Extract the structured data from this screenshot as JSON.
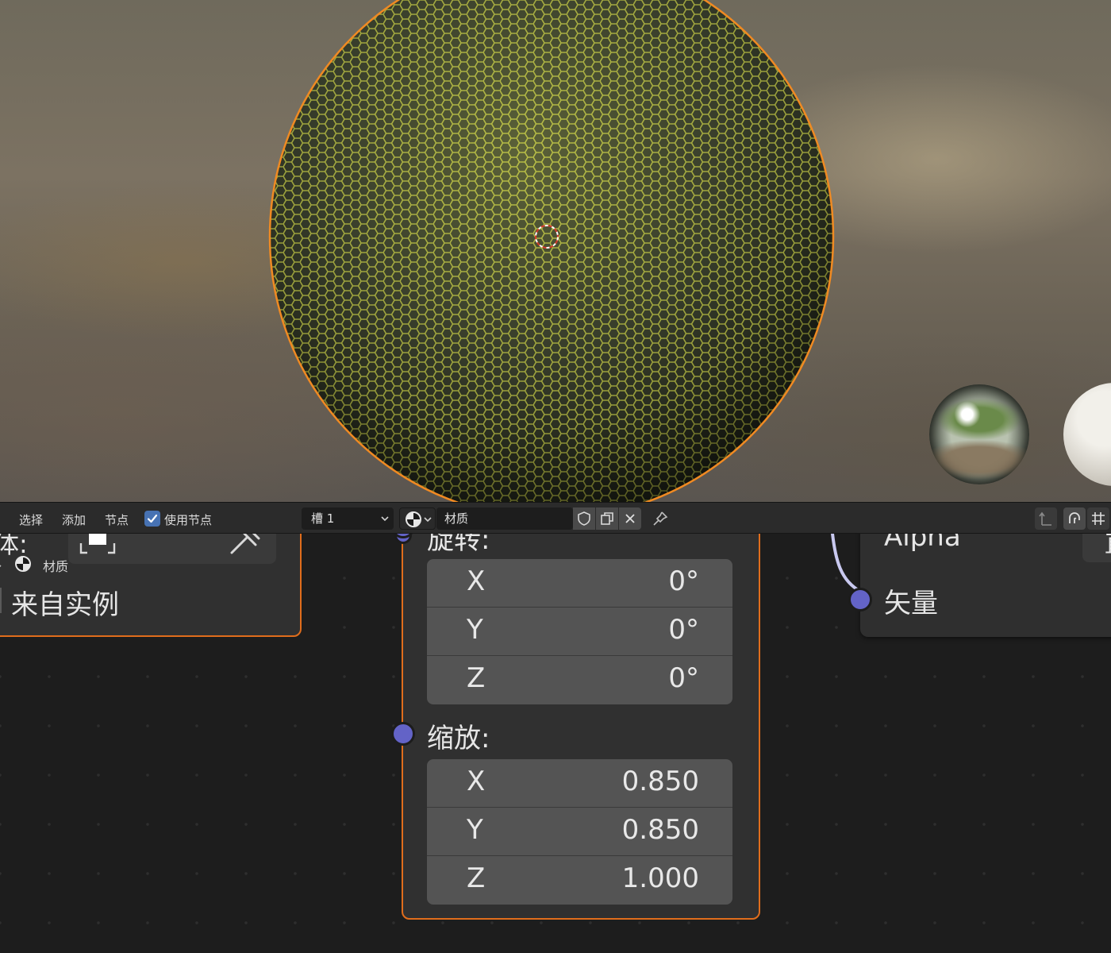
{
  "header": {
    "menu": [
      "选择",
      "添加",
      "节点"
    ],
    "use_nodes_label": "使用节点",
    "use_nodes_checked": true,
    "slot_value": "槽 1",
    "material_name": "材质",
    "icons": [
      "material-ball-icon",
      "chevron-down-icon",
      "fake-user-shield-icon",
      "duplicate-icon",
      "close-icon",
      "pin-icon",
      "parent-node-icon",
      "snap-icon",
      "grid-icon"
    ]
  },
  "nodes": {
    "left": {
      "cut_label": "体:",
      "material_label": "材质",
      "from_instance_label": "来自实例"
    },
    "mapping": {
      "rotation_label": "旋转:",
      "rotation": [
        {
          "axis": "X",
          "value": "0°"
        },
        {
          "axis": "Y",
          "value": "0°"
        },
        {
          "axis": "Z",
          "value": "0°"
        }
      ],
      "scale_label": "缩放:",
      "scale": [
        {
          "axis": "X",
          "value": "0.850"
        },
        {
          "axis": "Y",
          "value": "0.850"
        },
        {
          "axis": "Z",
          "value": "1.000"
        }
      ]
    },
    "right": {
      "alpha_label": "Alpha",
      "vector_label": "矢量"
    }
  },
  "colors": {
    "accent_selected": "#e06d1c",
    "socket_vector": "#6363c7",
    "checkbox_blue": "#4772b3",
    "sphere_hex_lines": "#c9cf4a"
  }
}
